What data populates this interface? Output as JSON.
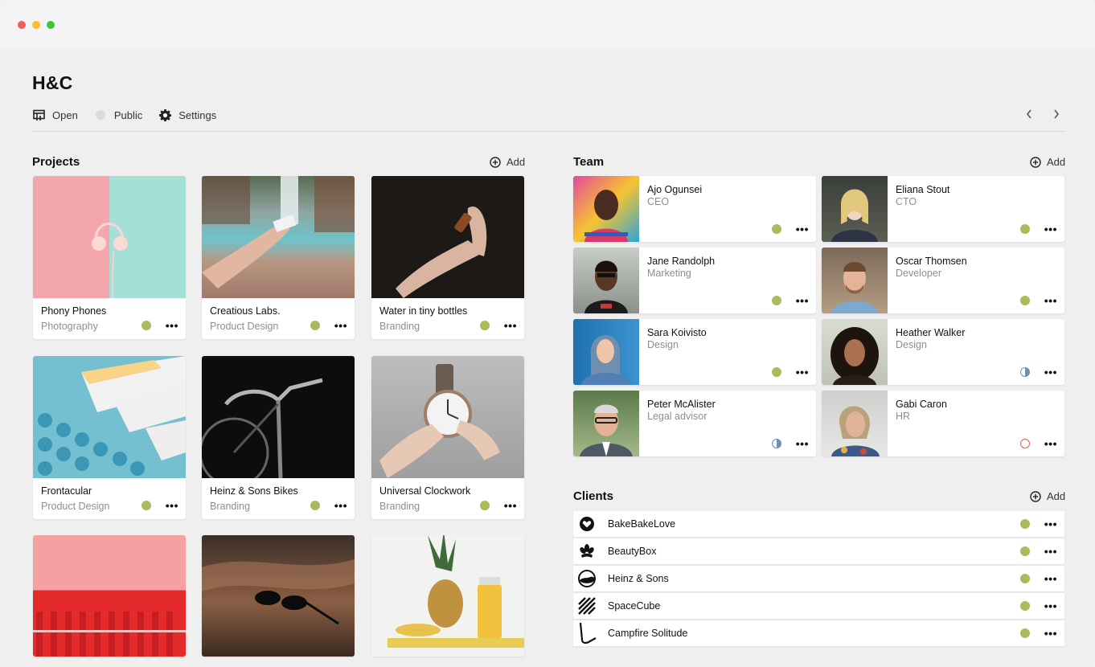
{
  "window": {
    "title": ""
  },
  "app": {
    "title": "H&C"
  },
  "toolbar": {
    "open_label": "Open",
    "public_label": "Public",
    "settings_label": "Settings",
    "prev_icon": "chevron-left-icon",
    "next_icon": "chevron-right-icon"
  },
  "colors": {
    "status_active": "#a7bc5b",
    "status_partial": "#6f8fb8",
    "status_inactive": "#e65a4c"
  },
  "projects": {
    "title": "Projects",
    "add_label": "Add",
    "items": [
      {
        "name": "Phony Phones",
        "category": "Photography",
        "status": "active"
      },
      {
        "name": "Creatious Labs.",
        "category": "Product Design",
        "status": "active"
      },
      {
        "name": "Water in tiny bottles",
        "category": "Branding",
        "status": "active"
      },
      {
        "name": "Frontacular",
        "category": "Product Design",
        "status": "active"
      },
      {
        "name": "Heinz & Sons Bikes",
        "category": "Branding",
        "status": "active"
      },
      {
        "name": "Universal Clockwork",
        "category": "Branding",
        "status": "active"
      },
      {
        "name": "",
        "category": "",
        "status": ""
      },
      {
        "name": "",
        "category": "",
        "status": ""
      },
      {
        "name": "",
        "category": "",
        "status": ""
      }
    ]
  },
  "team": {
    "title": "Team",
    "add_label": "Add",
    "members": [
      {
        "name": "Ajo Ogunsei",
        "role": "CEO",
        "status": "active"
      },
      {
        "name": "Eliana Stout",
        "role": "CTO",
        "status": "active"
      },
      {
        "name": "Jane Randolph",
        "role": "Marketing",
        "status": "active"
      },
      {
        "name": "Oscar Thomsen",
        "role": "Developer",
        "status": "active"
      },
      {
        "name": "Sara Koivisto",
        "role": "Design",
        "status": "active"
      },
      {
        "name": "Heather Walker",
        "role": "Design",
        "status": "partial"
      },
      {
        "name": "Peter McAlister",
        "role": "Legal advisor",
        "status": "partial"
      },
      {
        "name": "Gabi Caron",
        "role": "HR",
        "status": "inactive"
      }
    ]
  },
  "clients": {
    "title": "Clients",
    "add_label": "Add",
    "items": [
      {
        "name": "BakeBakeLove",
        "logo": "heart-badge-icon",
        "status": "active"
      },
      {
        "name": "BeautyBox",
        "logo": "flower-icon",
        "status": "active"
      },
      {
        "name": "Heinz & Sons",
        "logo": "circle-wave-icon",
        "status": "active"
      },
      {
        "name": "SpaceCube",
        "logo": "stripes-icon",
        "status": "active"
      },
      {
        "name": "Campfire Solitude",
        "logo": "campfire-curve-icon",
        "status": "active"
      }
    ]
  }
}
